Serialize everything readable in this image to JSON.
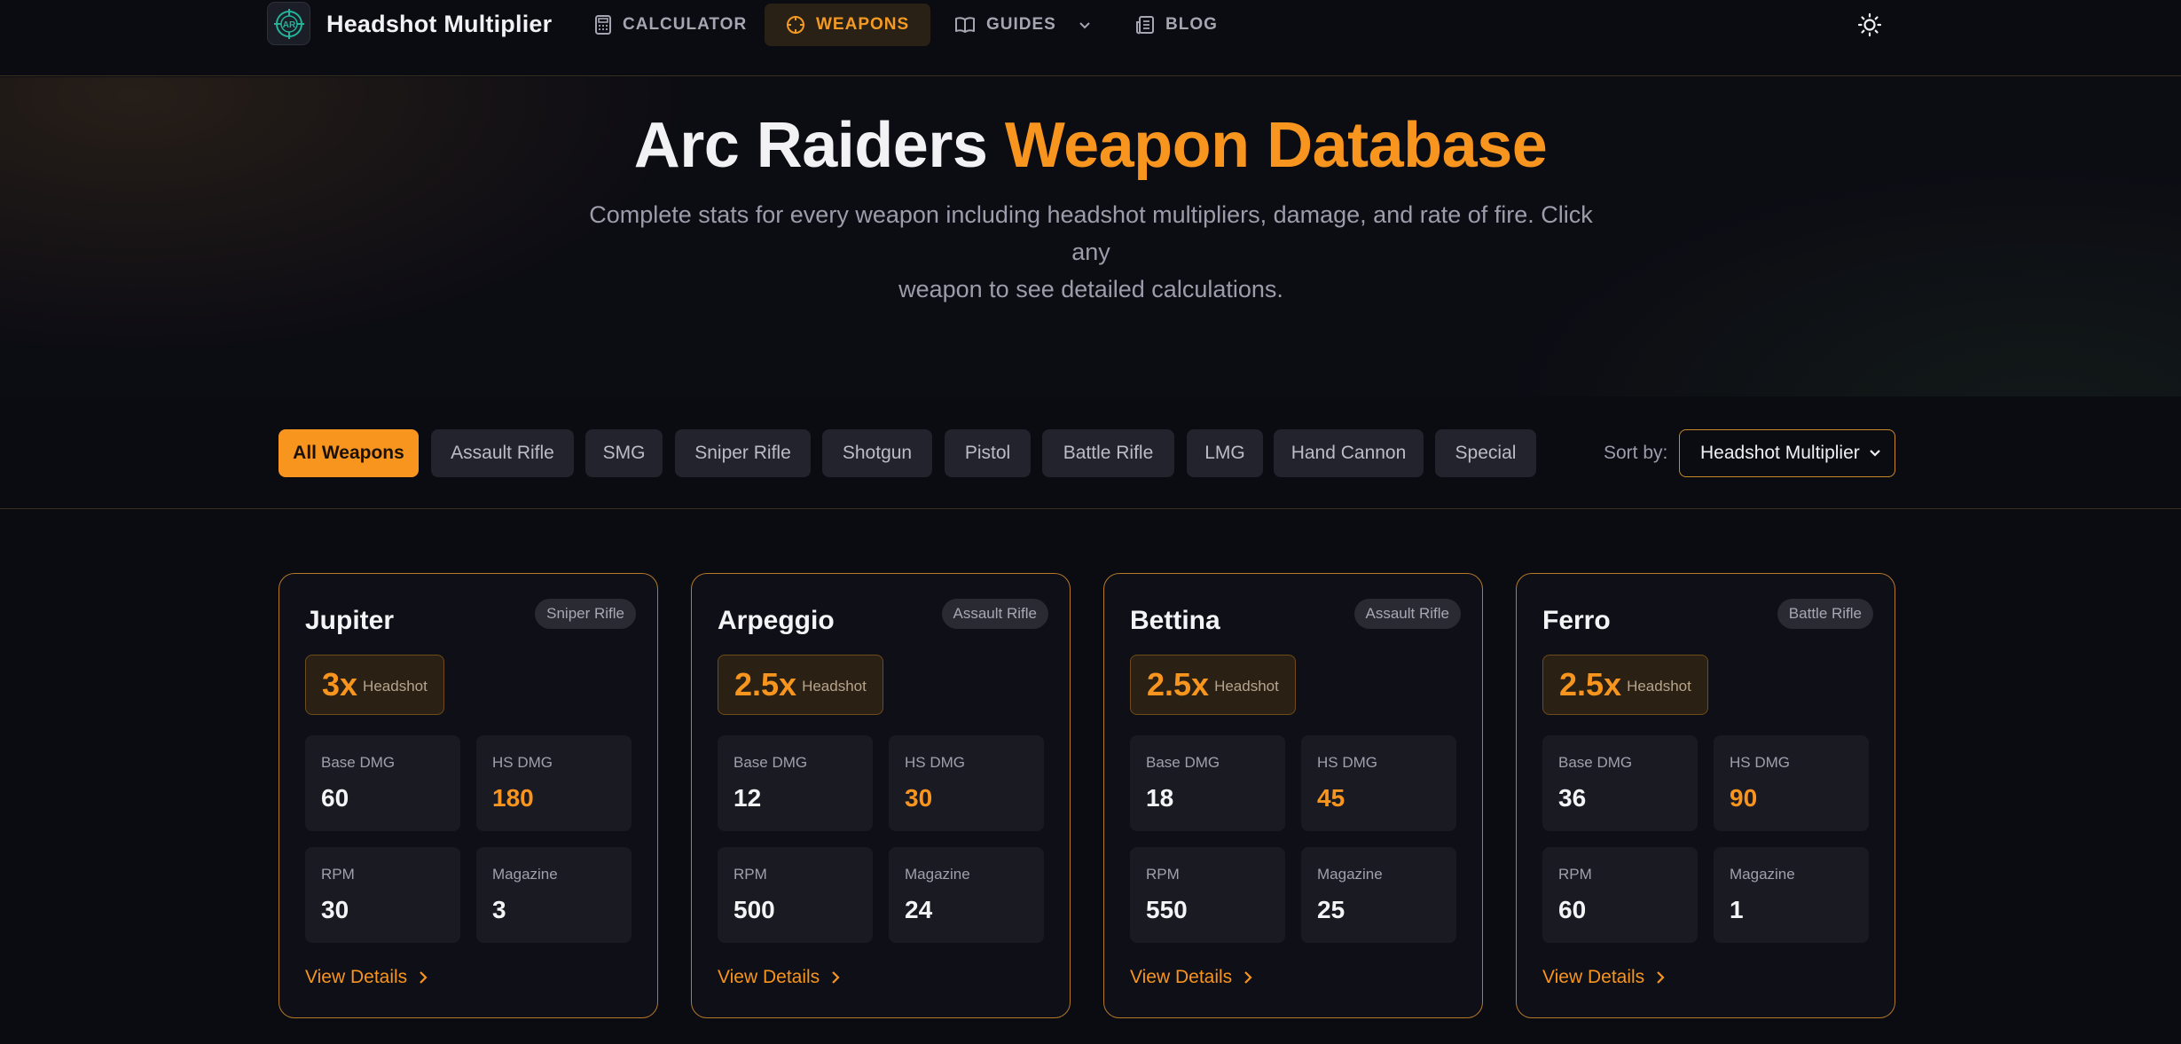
{
  "brand": {
    "title": "Headshot Multiplier",
    "logo_text": "AR"
  },
  "nav": [
    {
      "label": "CALCULATOR",
      "icon": "calculator-icon",
      "active": false
    },
    {
      "label": "WEAPONS",
      "icon": "crosshair-icon",
      "active": true
    },
    {
      "label": "GUIDES",
      "icon": "book-icon",
      "active": false,
      "has_dropdown": true
    },
    {
      "label": "BLOG",
      "icon": "newspaper-icon",
      "active": false
    }
  ],
  "theme_toggle_icon": "sun-icon",
  "hero": {
    "title_part1": "Arc Raiders",
    "title_part2": "Weapon Database",
    "subtitle_line1": "Complete stats for every weapon including headshot multipliers, damage, and rate of fire. Click any",
    "subtitle_line2": "weapon to see detailed calculations."
  },
  "filters": [
    "All Weapons",
    "Assault Rifle",
    "SMG",
    "Sniper Rifle",
    "Shotgun",
    "Pistol",
    "Battle Rifle",
    "LMG",
    "Hand Cannon",
    "Special"
  ],
  "active_filter": "All Weapons",
  "sort": {
    "label": "Sort by:",
    "value": "Headshot Multiplier"
  },
  "stat_labels": {
    "base": "Base DMG",
    "hs": "HS DMG",
    "rpm": "RPM",
    "mag": "Magazine",
    "headshot": "Headshot",
    "view": "View Details"
  },
  "weapons": [
    {
      "name": "Jupiter",
      "type": "Sniper Rifle",
      "multiplier": "3x",
      "base_dmg": "60",
      "hs_dmg": "180",
      "rpm": "30",
      "magazine": "3"
    },
    {
      "name": "Arpeggio",
      "type": "Assault Rifle",
      "multiplier": "2.5x",
      "base_dmg": "12",
      "hs_dmg": "30",
      "rpm": "500",
      "magazine": "24"
    },
    {
      "name": "Bettina",
      "type": "Assault Rifle",
      "multiplier": "2.5x",
      "base_dmg": "18",
      "hs_dmg": "45",
      "rpm": "550",
      "magazine": "25"
    },
    {
      "name": "Ferro",
      "type": "Battle Rifle",
      "multiplier": "2.5x",
      "base_dmg": "36",
      "hs_dmg": "90",
      "rpm": "60",
      "magazine": "1"
    }
  ],
  "colors": {
    "accent": "#f7951f",
    "background": "#0b0b12",
    "card_border": "#b5792a"
  }
}
